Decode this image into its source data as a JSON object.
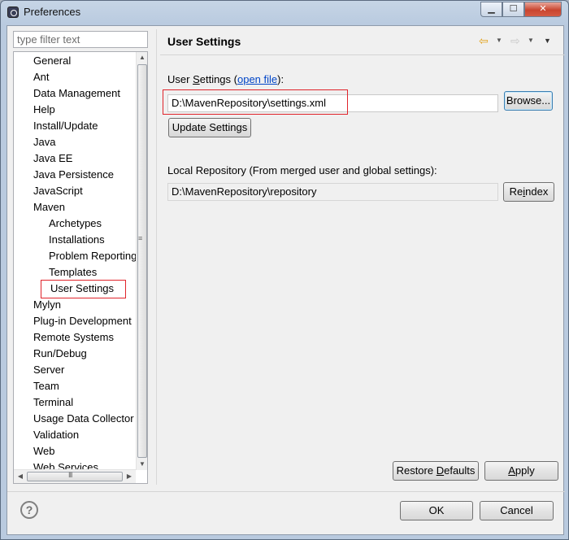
{
  "window": {
    "title": "Preferences",
    "minimize_glyph": "▁",
    "maximize_glyph": "☐",
    "close_glyph": "✕"
  },
  "sidebar": {
    "filter_placeholder": "type filter text",
    "items": [
      {
        "label": "General",
        "level": 0
      },
      {
        "label": "Ant",
        "level": 0
      },
      {
        "label": "Data Management",
        "level": 0
      },
      {
        "label": "Help",
        "level": 0
      },
      {
        "label": "Install/Update",
        "level": 0
      },
      {
        "label": "Java",
        "level": 0
      },
      {
        "label": "Java EE",
        "level": 0
      },
      {
        "label": "Java Persistence",
        "level": 0
      },
      {
        "label": "JavaScript",
        "level": 0
      },
      {
        "label": "Maven",
        "level": 0
      },
      {
        "label": "Archetypes",
        "level": 1
      },
      {
        "label": "Installations",
        "level": 1
      },
      {
        "label": "Problem Reporting",
        "level": 1
      },
      {
        "label": "Templates",
        "level": 1
      },
      {
        "label": "User Settings",
        "level": 1,
        "selected": true
      },
      {
        "label": "Mylyn",
        "level": 0
      },
      {
        "label": "Plug-in Development",
        "level": 0
      },
      {
        "label": "Remote Systems",
        "level": 0
      },
      {
        "label": "Run/Debug",
        "level": 0
      },
      {
        "label": "Server",
        "level": 0
      },
      {
        "label": "Team",
        "level": 0
      },
      {
        "label": "Terminal",
        "level": 0
      },
      {
        "label": "Usage Data Collector",
        "level": 0
      },
      {
        "label": "Validation",
        "level": 0
      },
      {
        "label": "Web",
        "level": 0
      },
      {
        "label": "Web Services",
        "level": 0
      }
    ],
    "scroll_up_glyph": "▲",
    "scroll_down_glyph": "▼",
    "scroll_left_glyph": "◀",
    "scroll_right_glyph": "▶",
    "vgrip_glyph": "≡",
    "hgrip_glyph": "III"
  },
  "page": {
    "title": "User Settings",
    "nav_icons": [
      "back-arrow-icon",
      "back-menu-icon",
      "forward-arrow-icon",
      "forward-menu-icon",
      "view-menu-icon"
    ],
    "nav_glyphs": {
      "back": "⇦",
      "back_menu": "▼",
      "forward": "⇨",
      "forward_menu": "▼",
      "view_menu": "▼"
    },
    "user_settings_label_pre": "User ",
    "user_settings_label_accel": "S",
    "user_settings_label_post": "ettings (",
    "open_file_link": "open file",
    "user_settings_label_end": "):",
    "user_settings_value": "D:\\MavenRepository\\settings.xml",
    "browse_button": "Browse...",
    "update_settings_button": "Update Settings",
    "local_repo_label": "Local Repository (From merged user and global settings):",
    "local_repo_value": "D:\\MavenRepository\\repository",
    "reindex_pre": "Re",
    "reindex_accel": "i",
    "reindex_post": "ndex",
    "restore_pre": "Restore ",
    "restore_accel": "D",
    "restore_post": "efaults",
    "apply_accel": "A",
    "apply_post": "pply"
  },
  "footer": {
    "help_glyph": "?",
    "ok_button": "OK",
    "cancel_button": "Cancel"
  },
  "colors": {
    "highlight_box": "#e0242b",
    "link": "#0045c7",
    "back_arrow": "#e3a21a"
  }
}
